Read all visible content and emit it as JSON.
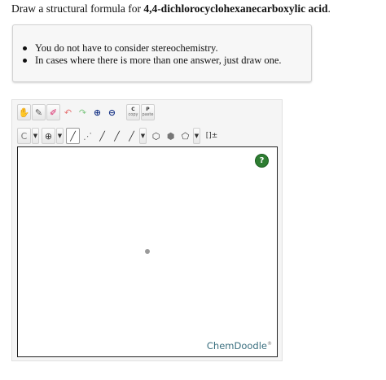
{
  "question": {
    "prefix": "Draw a structural formula for ",
    "compound": "4,4-dichlorocyclohexanecarboxylic acid",
    "suffix": "."
  },
  "hints": [
    "You do not have to consider stereochemistry.",
    "In cases where there is more than one answer, just draw one."
  ],
  "toolbar": {
    "row1": [
      {
        "name": "pan-tool-button",
        "icon": "hand-icon",
        "glyph": "✋"
      },
      {
        "name": "lasso-tool-button",
        "icon": "lasso-icon",
        "glyph": "✎"
      },
      {
        "name": "eraser-tool-button",
        "icon": "eraser-icon",
        "glyph": "✐"
      },
      {
        "name": "undo-button",
        "icon": "undo-icon",
        "glyph": "↶"
      },
      {
        "name": "redo-button",
        "icon": "redo-icon",
        "glyph": "↷"
      },
      {
        "name": "zoom-in-button",
        "icon": "zoom-in-icon",
        "glyph": "⊕"
      },
      {
        "name": "zoom-out-button",
        "icon": "zoom-out-icon",
        "glyph": "⊖"
      }
    ],
    "copy": {
      "letter": "C",
      "label": "copy"
    },
    "paste": {
      "letter": "P",
      "label": "paste"
    },
    "row2": {
      "element_label": "C",
      "charge_glyph": "⊕",
      "bond_glyphs": [
        "╱",
        "⋰",
        "╱",
        "╱",
        "╱"
      ],
      "ring_glyphs": [
        "⬡",
        "⬢",
        "⬠"
      ],
      "bracket_label": "[]±",
      "dropdown_glyph": "▼"
    }
  },
  "canvas": {
    "help_label": "?",
    "brand_name": "ChemDoodle",
    "brand_mark": "®"
  },
  "colors": {
    "help_green": "#2e7d32",
    "brand_teal": "#3a6f7f",
    "canvas_border": "#222222"
  }
}
